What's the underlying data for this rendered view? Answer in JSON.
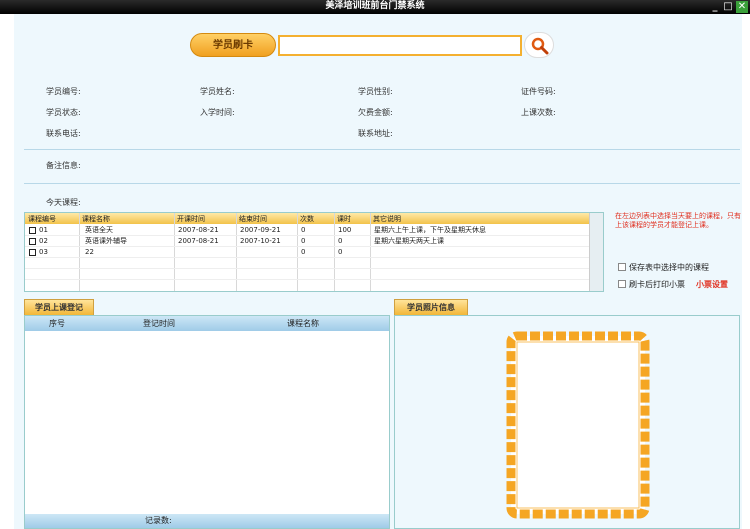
{
  "window": {
    "title": "美泽培训班前台门禁系统",
    "min_label": "_",
    "max_label": "□",
    "close_label": "✕"
  },
  "card": {
    "label": "学员刷卡",
    "input_value": "",
    "search_icon": "magnifier-icon"
  },
  "info": {
    "student_no": "学员编号:",
    "student_name": "学员姓名:",
    "gender": "学员性别:",
    "id_no": "证件号码:",
    "status": "学员状态:",
    "enroll_time": "入学时间:",
    "arrears": "欠费金额:",
    "class_count": "上课次数:",
    "phone": "联系电话:",
    "address": "联系地址:",
    "remarks": "备注信息:",
    "today_courses": "今天课程:"
  },
  "course_table": {
    "headers": [
      "课程编号",
      "课程名称",
      "开课时间",
      "结束时间",
      "次数",
      "课时",
      "其它说明"
    ],
    "rows": [
      [
        "01",
        "英语全天",
        "2007-08-21",
        "2007-09-21",
        "0",
        "100",
        "星期六上午上课，下午及星期天休息"
      ],
      [
        "02",
        "英语课外辅导",
        "2007-08-21",
        "2007-10-21",
        "0",
        "0",
        "星期六星期天两天上课"
      ],
      [
        "03",
        "22",
        "",
        "",
        "0",
        "0",
        ""
      ]
    ]
  },
  "note": "在左边列表中选择当天要上的课程，只有上该课程的学员才能登记上课。",
  "options": {
    "save_selected": "保存表中选择中的课程",
    "print_ticket": "刷卡后打印小票",
    "ticket_settings": "小票设置"
  },
  "attendance": {
    "tab": "学员上课登记",
    "headers": [
      "序号",
      "登记时间",
      "课程名称"
    ],
    "footer": "记录数:"
  },
  "photo": {
    "tab": "学员照片信息"
  },
  "colors": {
    "accent": "#f2b638",
    "frame": "#f5a623",
    "note": "#e03020"
  }
}
